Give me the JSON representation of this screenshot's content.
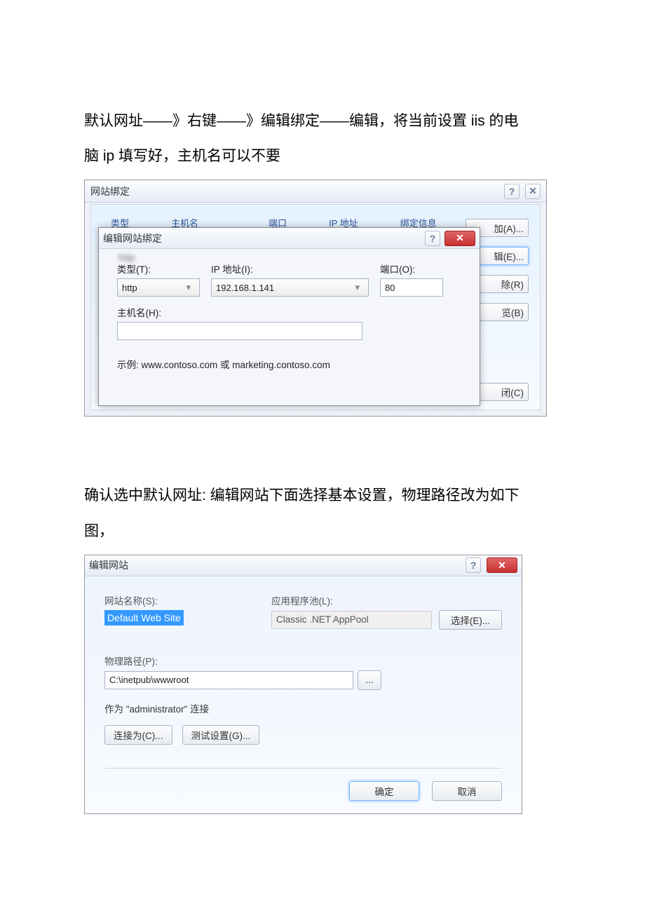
{
  "doc": {
    "para1_line1": "默认网址——》右键——》编辑绑定——编辑，将当前设置 iis 的电",
    "para1_line2": "脑 ip 填写好，主机名可以不要",
    "para2_line1": "确认选中默认网址: 编辑网站下面选择基本设置，物理路径改为如下",
    "para2_line2": "图，"
  },
  "dialog1": {
    "title": "网站绑定",
    "help": "?",
    "close": "✕",
    "columns": {
      "type": "类型",
      "host": "主机名",
      "port": "端口",
      "ip": "IP 地址",
      "binding": "绑定信息"
    },
    "side_buttons": {
      "add": "加(A)...",
      "edit": "辑(E)...",
      "remove": "除(R)",
      "browse": "览(B)",
      "close": "闭(C)"
    },
    "inner": {
      "title": "编辑网站绑定",
      "help": "?",
      "close": "✕",
      "type_label": "类型(T):",
      "type_value": "http",
      "ip_label": "IP 地址(I):",
      "ip_value": "192.168.1.141",
      "port_label": "端口(O):",
      "port_value": "80",
      "host_label": "主机名(H):",
      "host_value": "",
      "example": "示例: www.contoso.com 或 marketing.contoso.com"
    }
  },
  "dialog2": {
    "title": "编辑网站",
    "help": "?",
    "close": "✕",
    "site_name_label": "网站名称(S):",
    "site_name_value": "Default Web Site",
    "app_pool_label": "应用程序池(L):",
    "app_pool_value": "Classic .NET AppPool",
    "select_btn": "选择(E)...",
    "physical_path_label": "物理路径(P):",
    "physical_path_value": "C:\\inetpub\\wwwroot",
    "browse_btn": "...",
    "connect_as_text": "作为 \"administrator\" 连接",
    "connect_btn": "连接为(C)...",
    "test_btn": "测试设置(G)...",
    "ok_btn": "确定",
    "cancel_btn": "取消"
  }
}
